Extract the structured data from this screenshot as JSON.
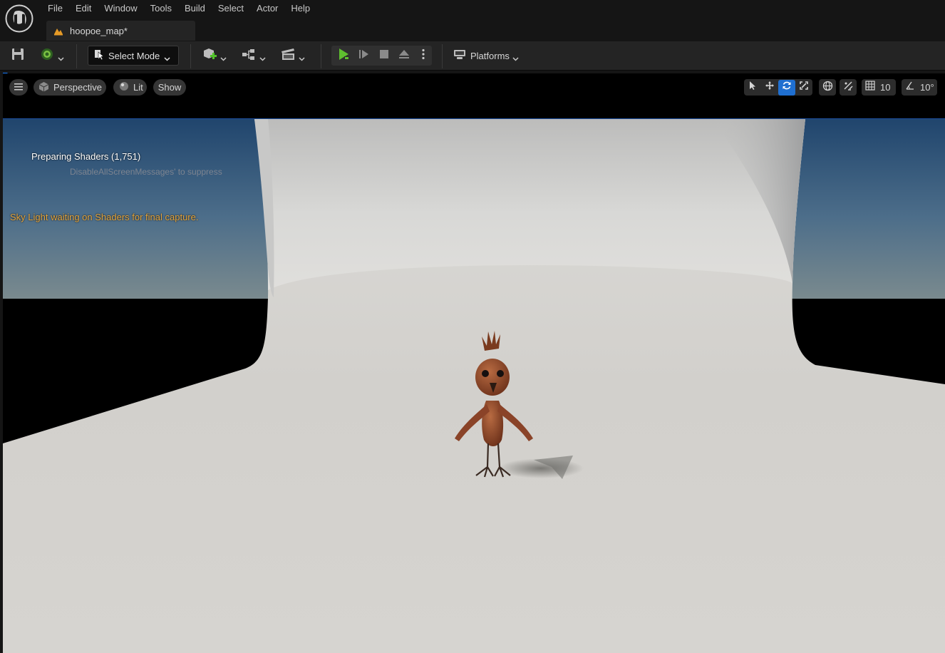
{
  "app": {
    "logo_icon": "unreal-engine-logo-icon",
    "menu": [
      "File",
      "Edit",
      "Window",
      "Tools",
      "Build",
      "Select",
      "Actor",
      "Help"
    ],
    "map_tab": {
      "label": "hoopoe_map*",
      "icon": "level-map-icon"
    }
  },
  "toolbar": {
    "save_icon": "save-icon",
    "source_control_icon": "source-control-icon",
    "select_mode_label": "Select Mode",
    "add_icon": "add-actor-icon",
    "blueprint_icon": "blueprint-icon",
    "cinematics_icon": "cinematics-icon",
    "play_icons": [
      "play-icon",
      "advance-frame-icon",
      "stop-icon",
      "eject-icon",
      "more-options-icon"
    ],
    "platforms_label": "Platforms"
  },
  "viewport_toolbar": {
    "perspective_label": "Perspective",
    "lit_label": "Lit",
    "show_label": "Show",
    "grid_snap_value": "10",
    "rotation_snap_value": "10°",
    "transform_tools": [
      "select-icon",
      "translate-icon",
      "rotate-icon",
      "scale-icon"
    ],
    "active_tool": "rotate-icon"
  },
  "viewport_messages": {
    "preparing_shaders": "Preparing Shaders (1,751)",
    "suppress_hint": "DisableAllScreenMessages' to suppress",
    "skylight": "Sky Light waiting on Shaders for final capture."
  },
  "colors": {
    "accent_blue": "#1f6fd0",
    "warning_orange": "#e3a43c",
    "play_green": "#5fbf2f"
  }
}
